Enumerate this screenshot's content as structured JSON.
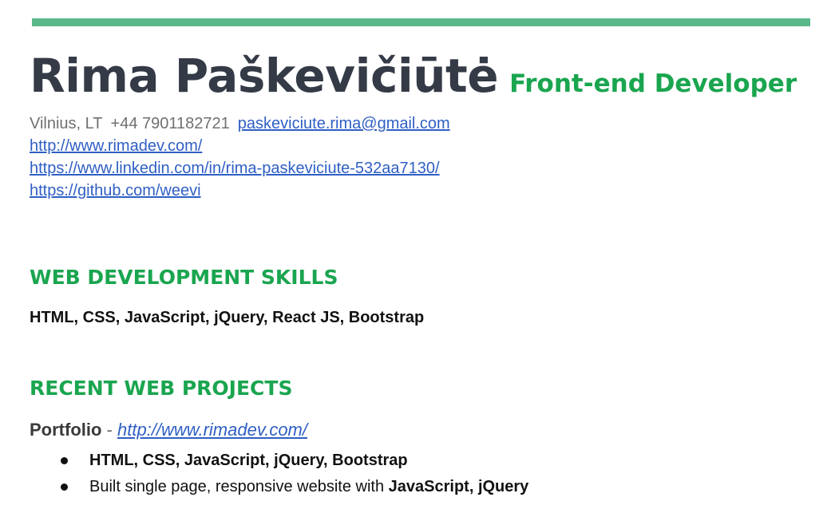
{
  "header": {
    "name": "Rima Paškevičiūtė",
    "role": "Front-end Developer",
    "accent_color": "#1aa54f",
    "rule_color": "#5ab88a"
  },
  "contact": {
    "location": "Vilnius, LT",
    "phone": "+44 7901182721",
    "email": "paskeviciute.rima@gmail.com",
    "website": "http://www.rimadev.com/",
    "linkedin": "https://www.linkedin.com/in/rima-paskeviciute-532aa7130/",
    "github": "https://github.com/weevi"
  },
  "skills": {
    "heading": "WEB DEVELOPMENT SKILLS",
    "list": "HTML, CSS, JavaScript, jQuery, React JS, Bootstrap"
  },
  "projects": {
    "heading": "RECENT WEB PROJECTS",
    "items": [
      {
        "name": "Portfolio",
        "separator": " - ",
        "url": "http://www.rimadev.com/",
        "bullets": [
          {
            "plain": "",
            "bold": "HTML, CSS, JavaScript, jQuery, Bootstrap"
          },
          {
            "plain": "Built single page, responsive website with ",
            "bold": "JavaScript, jQuery"
          }
        ]
      }
    ]
  }
}
